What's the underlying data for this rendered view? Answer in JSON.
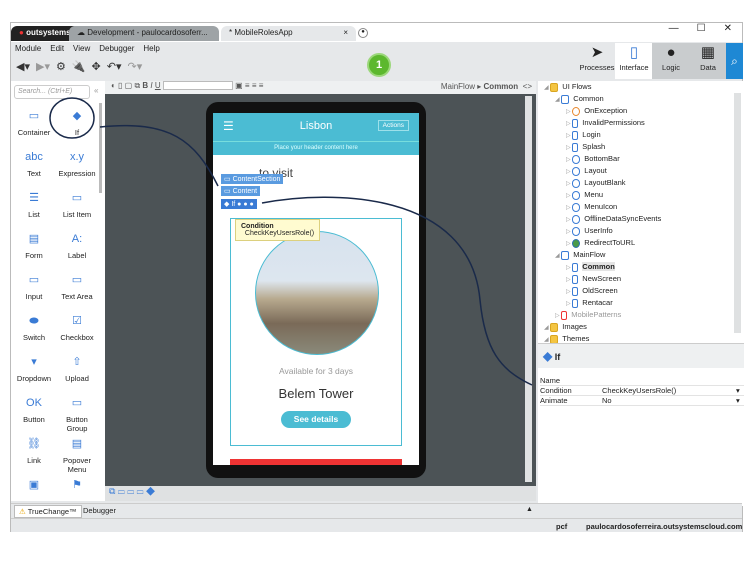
{
  "tabs": {
    "brand": "outsystems",
    "env": "Development - paulocardosoferr...",
    "app": "* MobileRolesApp"
  },
  "window_controls": {
    "minimize": "—",
    "maximize": "☐",
    "close": "✕"
  },
  "menu": [
    "Module",
    "Edit",
    "View",
    "Debugger",
    "Help"
  ],
  "publish_badge": "1",
  "right_tabs": [
    {
      "label": "Processes"
    },
    {
      "label": "Interface"
    },
    {
      "label": "Logic"
    },
    {
      "label": "Data"
    }
  ],
  "search": {
    "placeholder": "Search... (Ctrl+E)"
  },
  "palette": [
    {
      "label": "Container",
      "icon": "▭"
    },
    {
      "label": "If",
      "icon": "◆"
    },
    {
      "label": "Text",
      "icon": "abc"
    },
    {
      "label": "Expression",
      "icon": "x.y"
    },
    {
      "label": "List",
      "icon": "☰"
    },
    {
      "label": "List Item",
      "icon": "▭"
    },
    {
      "label": "Form",
      "icon": "▤"
    },
    {
      "label": "Label",
      "icon": "A:"
    },
    {
      "label": "Input",
      "icon": "▭"
    },
    {
      "label": "Text Area",
      "icon": "▭"
    },
    {
      "label": "Switch",
      "icon": "⬬"
    },
    {
      "label": "Checkbox",
      "icon": "☑"
    },
    {
      "label": "Dropdown",
      "icon": "▾"
    },
    {
      "label": "Upload",
      "icon": "⇧"
    },
    {
      "label": "Button",
      "icon": "OK"
    },
    {
      "label": "Button Group",
      "icon": "▭"
    },
    {
      "label": "Link",
      "icon": "⛓"
    },
    {
      "label": "Popover Menu",
      "icon": "▤"
    },
    {
      "label": "",
      "icon": "▣"
    },
    {
      "label": "",
      "icon": "⚑"
    }
  ],
  "breadcrumb": {
    "flow": "MainFlow",
    "screen": "Common",
    "code": "<>"
  },
  "phone": {
    "title": "Lisbon",
    "actions": "Actions",
    "header_placeholder": "Place your header content here",
    "heading": "...to visit",
    "available": "Available for 3 days",
    "place": "Belem Tower",
    "details_button": "See details"
  },
  "overlay": {
    "content_section": "ContentSection",
    "content": "Content",
    "if": "If",
    "tooltip_title": "Condition",
    "tooltip_value": "CheckKeyUsersRole()"
  },
  "tree": [
    {
      "label": "UI Flows",
      "level": 0,
      "kind": "folder"
    },
    {
      "label": "Common",
      "level": 1,
      "kind": "flow"
    },
    {
      "label": "OnException",
      "level": 2,
      "kind": "exception"
    },
    {
      "label": "InvalidPermissions",
      "level": 2,
      "kind": "screen"
    },
    {
      "label": "Login",
      "level": 2,
      "kind": "screen"
    },
    {
      "label": "Splash",
      "level": 2,
      "kind": "screen"
    },
    {
      "label": "BottomBar",
      "level": 2,
      "kind": "block"
    },
    {
      "label": "Layout",
      "level": 2,
      "kind": "block"
    },
    {
      "label": "LayoutBlank",
      "level": 2,
      "kind": "block"
    },
    {
      "label": "Menu",
      "level": 2,
      "kind": "block"
    },
    {
      "label": "MenuIcon",
      "level": 2,
      "kind": "block"
    },
    {
      "label": "OfflineDataSyncEvents",
      "level": 2,
      "kind": "block"
    },
    {
      "label": "UserInfo",
      "level": 2,
      "kind": "block"
    },
    {
      "label": "RedirectToURL",
      "level": 2,
      "kind": "web"
    },
    {
      "label": "MainFlow",
      "level": 1,
      "kind": "flow"
    },
    {
      "label": "Common",
      "level": 2,
      "kind": "screen",
      "selected": true
    },
    {
      "label": "NewScreen",
      "level": 2,
      "kind": "screen"
    },
    {
      "label": "OldScreen",
      "level": 2,
      "kind": "screen"
    },
    {
      "label": "Rentacar",
      "level": 2,
      "kind": "screen"
    },
    {
      "label": "MobilePatterns",
      "level": 1,
      "kind": "mobile"
    },
    {
      "label": "Images",
      "level": 0,
      "kind": "folder"
    },
    {
      "label": "Themes",
      "level": 0,
      "kind": "folder"
    }
  ],
  "properties": {
    "title": "If",
    "rows": [
      {
        "name": "Name",
        "value": ""
      },
      {
        "name": "Condition",
        "value": "CheckKeyUsersRole()"
      },
      {
        "name": "Animate",
        "value": "No"
      }
    ]
  },
  "bottom_tabs": [
    "TrueChange™",
    "Debugger"
  ],
  "status": {
    "user": "pcf",
    "server": "paulocardosoferreira.outsystemscloud.com"
  },
  "colors": {
    "accent": "#3a7bd5",
    "phone_header": "#4bbcd3",
    "canvas": "#4c5356",
    "publish": "#5cb82e"
  }
}
